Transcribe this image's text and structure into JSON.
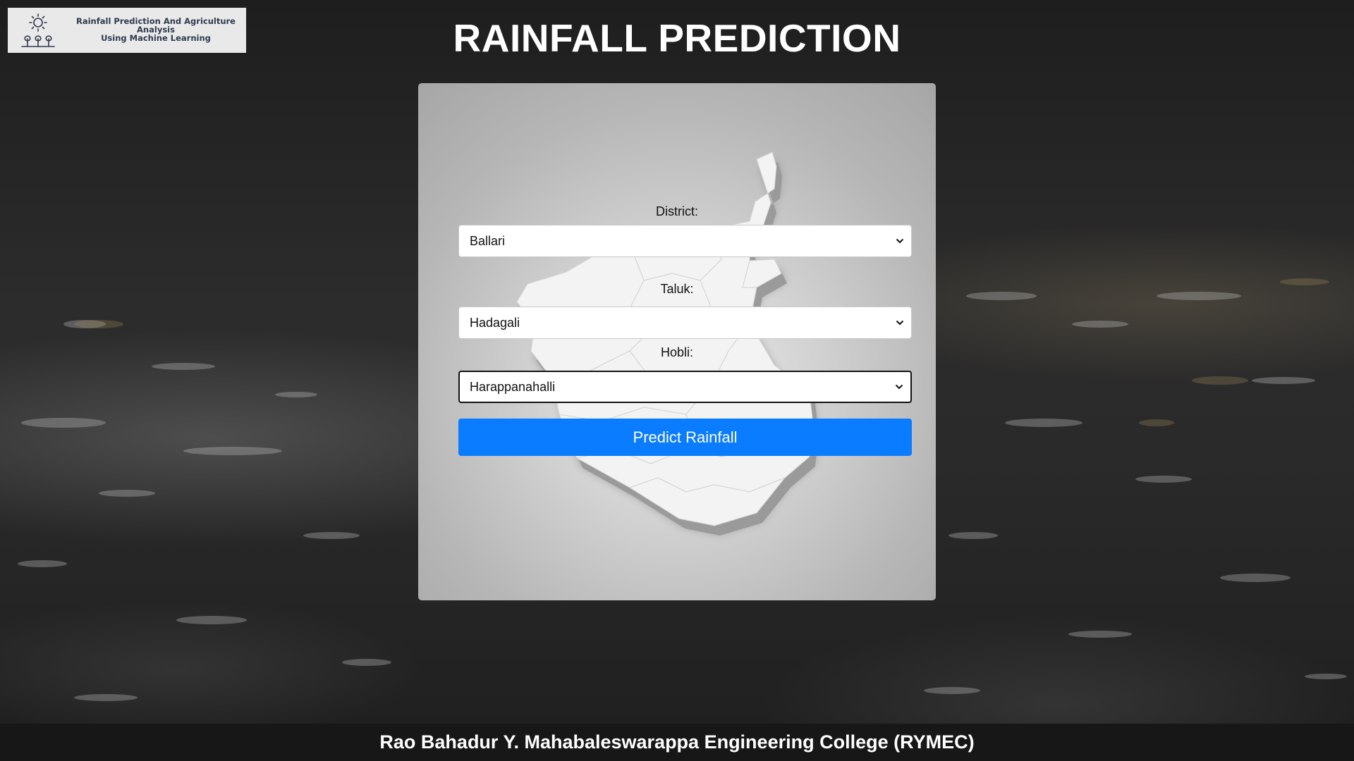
{
  "header": {
    "logo_line1": "Rainfall Prediction And Agriculture Analysis",
    "logo_line2": "Using Machine Learning",
    "title": "RAINFALL PREDICTION"
  },
  "form": {
    "district_label": "District:",
    "district_value": "Ballari",
    "taluk_label": "Taluk:",
    "taluk_value": "Hadagali",
    "hobli_label": "Hobli:",
    "hobli_value": "Harappanahalli",
    "submit_label": "Predict Rainfall"
  },
  "footer": {
    "text": "Rao Bahadur Y. Mahabaleswarappa Engineering College (RYMEC)"
  },
  "colors": {
    "primary_button": "#0a7cff",
    "title_text": "#ffffff",
    "footer_bg": "#171717"
  },
  "icons": {
    "logo": "sun-and-sprouts-icon",
    "select_arrow": "chevron-down-icon",
    "card_background": "karnataka-map-illustration"
  }
}
